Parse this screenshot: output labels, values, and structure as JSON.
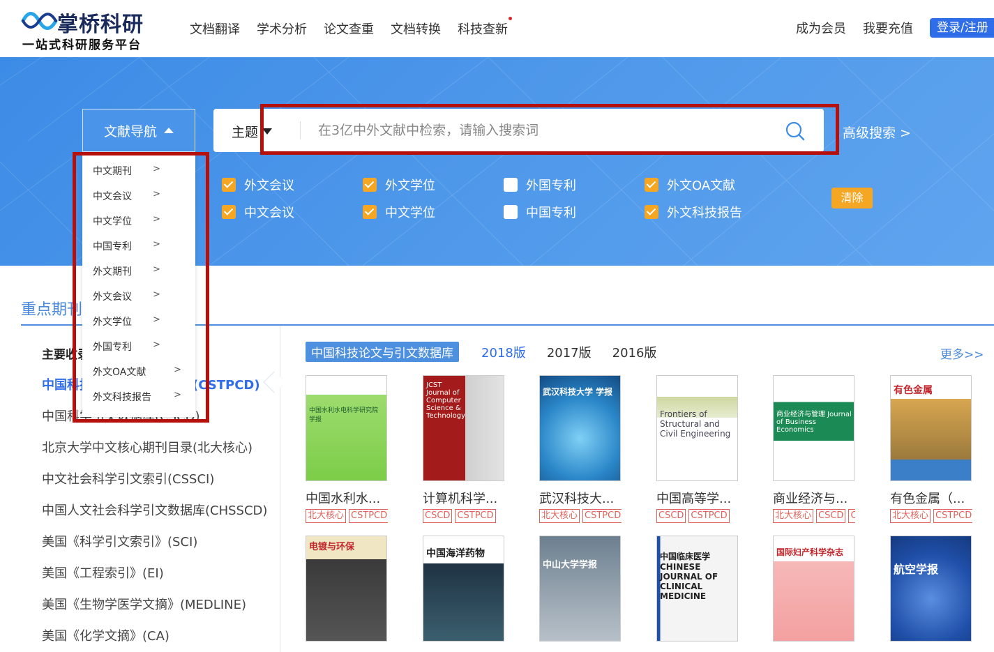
{
  "header": {
    "logo_title": "掌桥科研",
    "logo_subtitle": "一站式科研服务平台",
    "nav": [
      "文档翻译",
      "学术分析",
      "论文查重",
      "文档转换",
      "科技查新"
    ],
    "become_member": "成为会员",
    "recharge": "我要充值",
    "login": "登录/注册"
  },
  "search": {
    "lit_nav_label": "文献导航",
    "field_label": "主题",
    "placeholder": "在3亿中外文献中检索，请输入搜索词",
    "advanced": "高级搜索 >",
    "clear": "清除",
    "checkboxes": [
      {
        "label": "外文会议",
        "checked": true
      },
      {
        "label": "外文学位",
        "checked": true
      },
      {
        "label": "外国专利",
        "checked": false
      },
      {
        "label": "外文OA文献",
        "checked": true
      },
      {
        "label": "中文会议",
        "checked": true
      },
      {
        "label": "中文学位",
        "checked": true
      },
      {
        "label": "中国专利",
        "checked": false
      },
      {
        "label": "外文科技报告",
        "checked": true
      }
    ]
  },
  "dropdown": {
    "arrow": ">",
    "items": [
      "中文期刊",
      "中文会议",
      "中文学位",
      "中国专利",
      "外文期刊",
      "外文会议",
      "外文学位",
      "外国专利",
      "外文OA文献",
      "外文科技报告"
    ]
  },
  "section": {
    "tab": "重点期刊",
    "list_title": "主要收录",
    "list_items": [
      "中国科技论文与引文数据库(CSTPCD)",
      "中国科学引文数据库(CSCD)",
      "北京大学中文核心期刊目录(北大核心)",
      "中文社会科学引文索引(CSSCI)",
      "中国人文社会科学引文数据库(CHSSCD)",
      "美国《科学引文索引》(SCI)",
      "美国《工程索引》(EI)",
      "美国《生物学医学文摘》(MEDLINE)",
      "美国《化学文摘》(CA)"
    ],
    "list_visible": [
      "主要收录",
      "中国科技论文与引文数据库(CSTPCD)",
      "中国科学引文数据库(CSCD)"
    ],
    "db_main": "中国科技论文与引文数据库",
    "versions": [
      "2018版",
      "2017版",
      "2016版"
    ],
    "more": "更多>>"
  },
  "journals": [
    {
      "title": "中国水利水...",
      "tags": [
        "北大核心",
        "CSTPCD"
      ],
      "cover_text": "中国水利水电科学研究院 学报",
      "cover_color": "#8fd466"
    },
    {
      "title": "计算机科学...",
      "tags": [
        "CSCD",
        "CSTPCD"
      ],
      "cover_text": "JCST Journal of Computer Science & Technology",
      "cover_color": "#a81d1d"
    },
    {
      "title": "武汉科技大...",
      "tags": [
        "北大核心",
        "CSTPCD"
      ],
      "cover_text": "武汉科技大学 学报",
      "cover_color": "#2a86c8"
    },
    {
      "title": "中国高等学...",
      "tags": [
        "CSCD",
        "CSTPCD"
      ],
      "cover_text": "Frontiers of Structural and Civil Engineering",
      "cover_color": "#d7ddb6"
    },
    {
      "title": "商业经济与...",
      "tags": [
        "北大核心",
        "CSCD",
        "CSSCI"
      ],
      "cover_text": "商业经济与管理 Journal of Business Economics",
      "cover_color": "#1b8a55"
    },
    {
      "title": "有色金属（...",
      "tags": [
        "北大核心",
        "CSTPCD"
      ],
      "cover_text": "有色金属",
      "cover_color": "#c9a040"
    },
    {
      "title": "",
      "tags": [],
      "cover_text": "电镀与环保",
      "cover_color": "#3a3a3a"
    },
    {
      "title": "",
      "tags": [],
      "cover_text": "中国海洋药物",
      "cover_color": "#2e4a5e"
    },
    {
      "title": "",
      "tags": [],
      "cover_text": "中山大学学报",
      "cover_color": "#5d7080"
    },
    {
      "title": "",
      "tags": [],
      "cover_text": "中国临床医学 CHINESE JOURNAL OF CLINICAL MEDICINE",
      "cover_color": "#f4f4f4"
    },
    {
      "title": "",
      "tags": [],
      "cover_text": "国际妇产科学杂志",
      "cover_color": "#f6b8b8"
    },
    {
      "title": "",
      "tags": [],
      "cover_text": "航空学报",
      "cover_color": "#1f4fa8"
    }
  ]
}
